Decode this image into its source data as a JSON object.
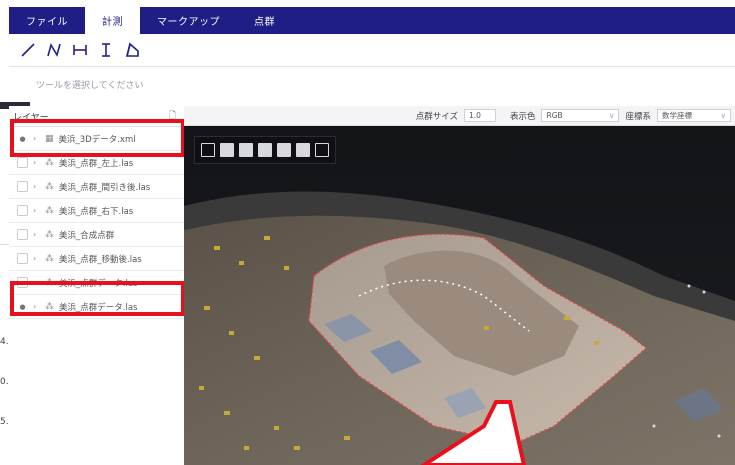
{
  "menu": {
    "tabs": [
      {
        "label": "ファイル",
        "active": false
      },
      {
        "label": "計測",
        "active": true
      },
      {
        "label": "マークアップ",
        "active": false
      },
      {
        "label": "点群",
        "active": false
      }
    ]
  },
  "tools": [
    "line-measure-icon",
    "polyline-measure-icon",
    "horizontal-distance-icon",
    "vertical-distance-icon",
    "area-measure-icon"
  ],
  "hint": "ツールを選択してください",
  "layers": {
    "title": "レイヤー",
    "items": [
      {
        "label": "美浜_3Dデータ.xml",
        "visible": true
      },
      {
        "label": "美浜_点群_左上.las",
        "visible": false
      },
      {
        "label": "美浜_点群_間引き後.las",
        "visible": false
      },
      {
        "label": "美浜_点群_右下.las",
        "visible": false
      },
      {
        "label": "美浜_合成点群",
        "visible": false
      },
      {
        "label": "美浜_点群_移動後.las",
        "visible": false
      },
      {
        "label": "美浜_点群データ.las",
        "visible": false
      },
      {
        "label": "美浜_点群データ.las",
        "visible": true
      }
    ]
  },
  "params": {
    "size_label": "点群サイズ",
    "size_value": "1.0",
    "color_label": "表示色",
    "color_value": "RGB",
    "coord_label": "座標系",
    "coord_value": "数学座標"
  },
  "edge_numbers": [
    "4.",
    "0.",
    "5."
  ],
  "colors": {
    "brand": "#1f1d86",
    "highlight": "#e8101c"
  }
}
